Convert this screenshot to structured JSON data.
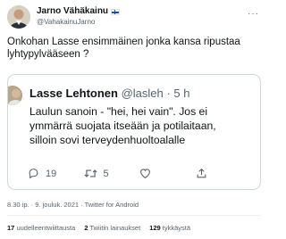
{
  "author": {
    "name": "Jarno Vähäkainu",
    "handle": "@VahakainuJarno",
    "badge_icon": "finland-flag-icon"
  },
  "tweet": {
    "text_line1": "Onkohan Lasse ensimmäinen jonka kansa ripustaa",
    "text_line2": "lyhtypylvääseen ?"
  },
  "quoted_tweet": {
    "name": "Lasse Lehtonen",
    "handle": "@lasleh",
    "separator": "·",
    "time": "5 h",
    "text_line1": "Laulun sanoin - \"hei, hei vain\". Jos ei",
    "text_line2": "ymmärrä suojata itseään ja potilaitaan,",
    "text_line3": "silloin sovi terveydenhuoltoalalle",
    "actions": {
      "replies": "19",
      "retweets": "5",
      "likes": ""
    }
  },
  "meta": {
    "timestamp": "8.30 ip. · 9. jouluk. 2021 · Twitter for Android"
  },
  "stats": {
    "quote_count": "17",
    "quote_label": "uudelleentwiittausta",
    "retweet_count": "2",
    "retweet_label": "Twiitin lainaukset",
    "like_count": "129",
    "like_label": "tykkäystä"
  },
  "colors": {
    "text": "#0f1419",
    "secondary": "#536471",
    "border": "#cfd9de"
  }
}
